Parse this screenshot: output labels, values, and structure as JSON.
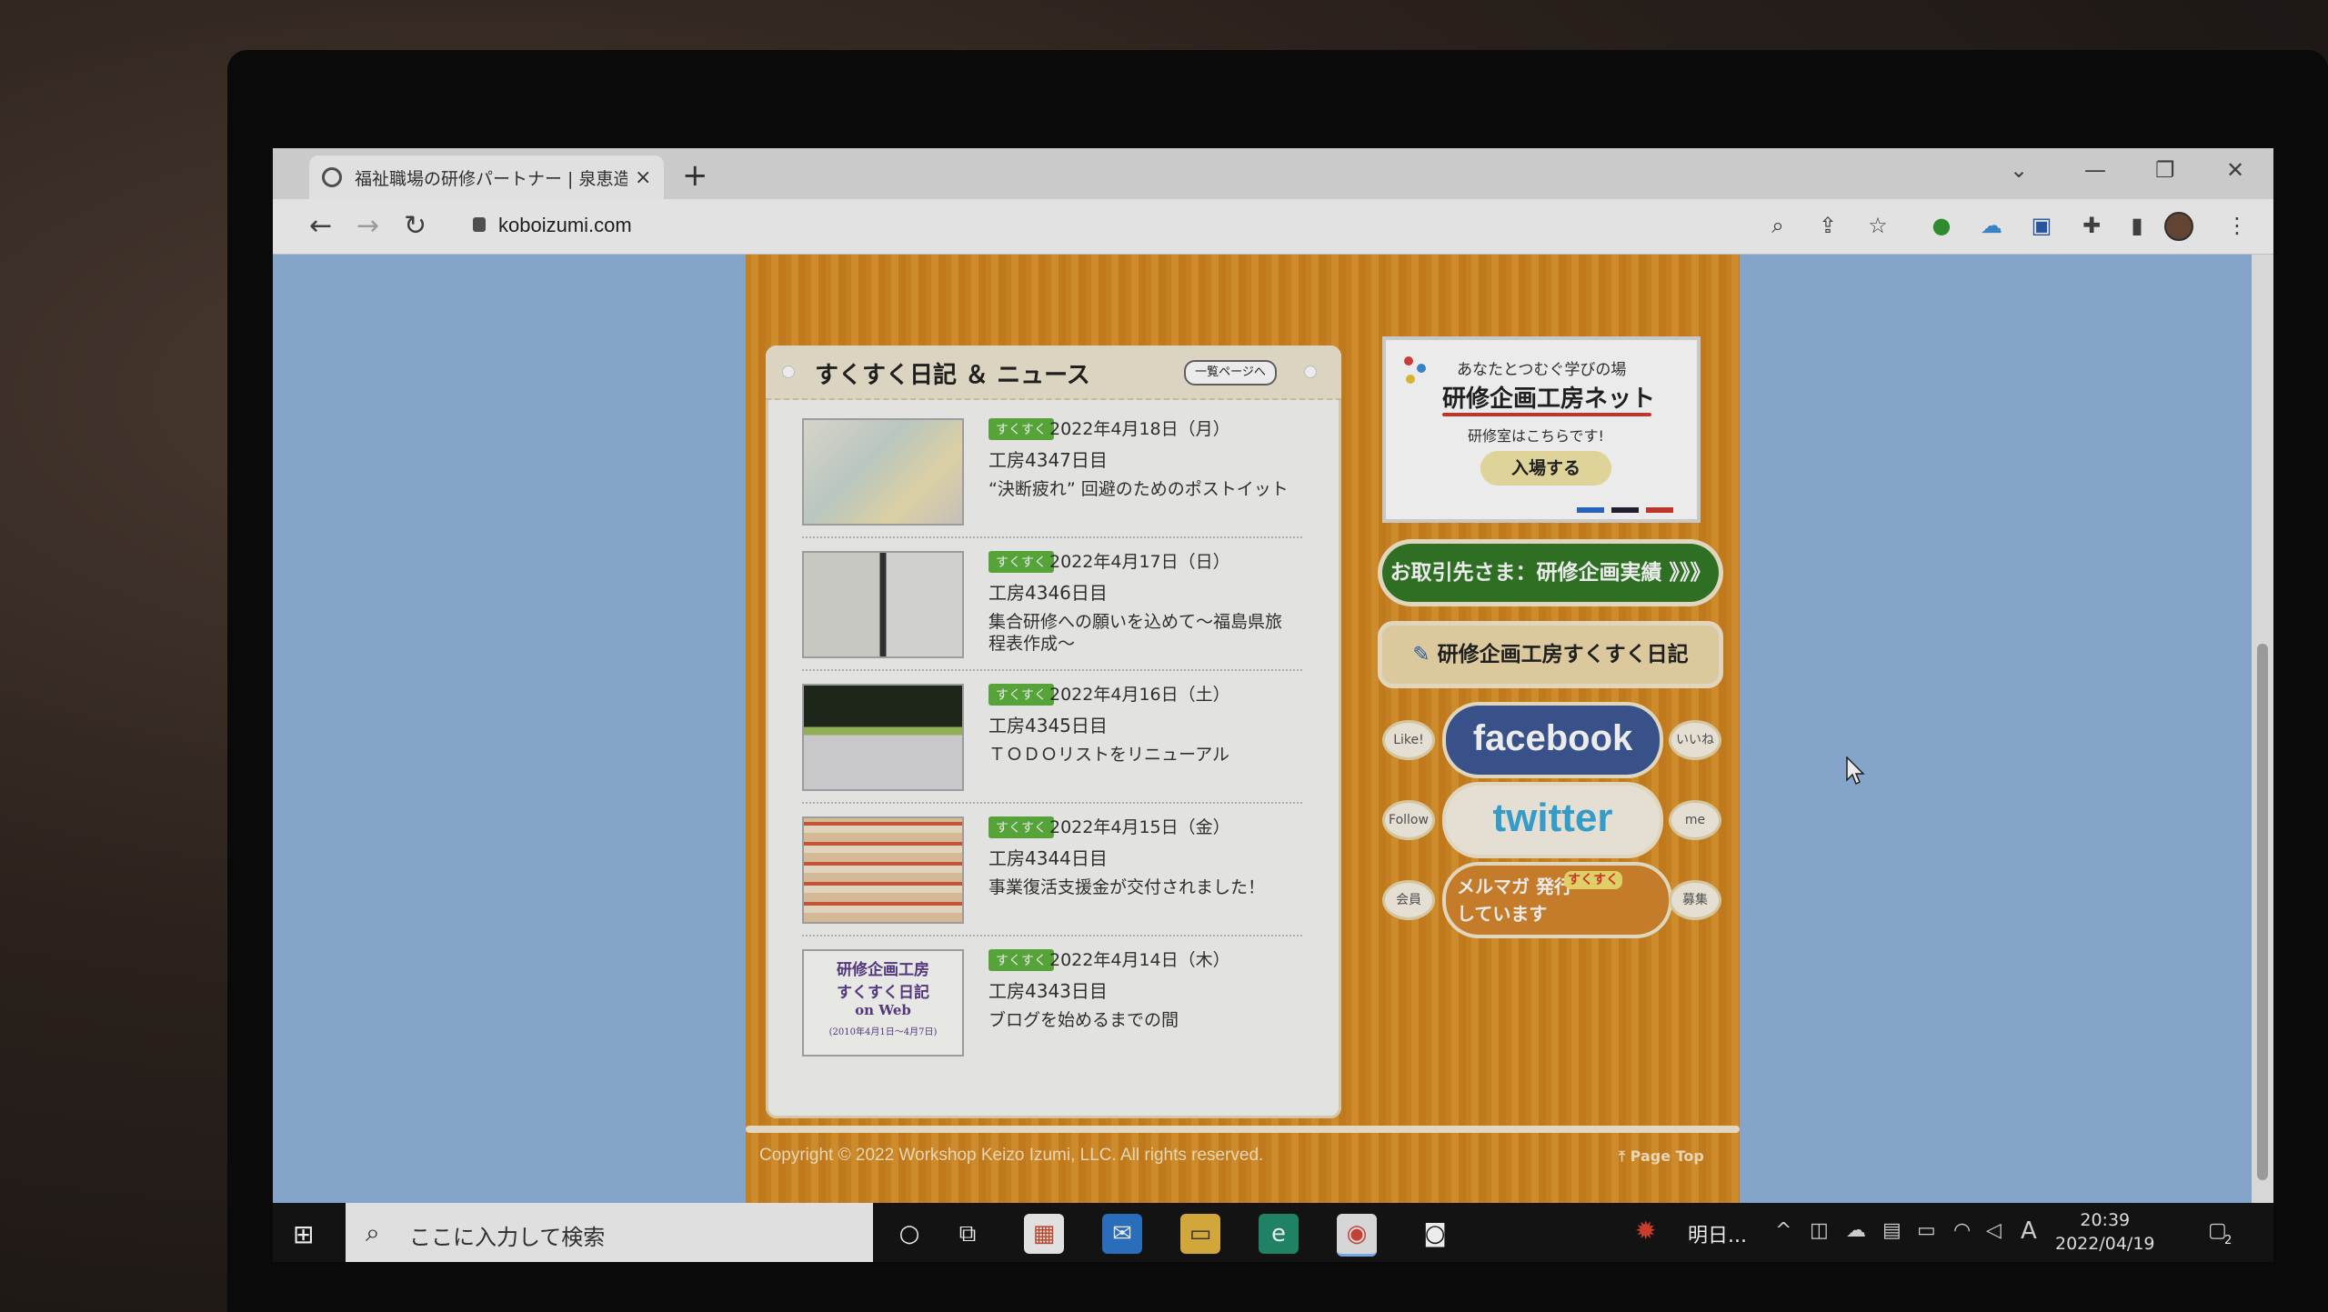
{
  "browser": {
    "tab_title": "福祉職場の研修パートナー | 泉恵造",
    "tab_close": "×",
    "new_tab": "+",
    "url": "koboizumi.com",
    "back": "←",
    "forward": "→",
    "reload": "↻"
  },
  "news": {
    "title": "すくすく日記 ＆ ニュース",
    "more_label": "一覧ページへ",
    "items": [
      {
        "badge": "すくすく",
        "date": "2022年4月18日（月）",
        "day": "工房4347日目",
        "post": "“決断疲れ” 回避のためのポストイット"
      },
      {
        "badge": "すくすく",
        "date": "2022年4月17日（日）",
        "day": "工房4346日目",
        "post": "集合研修への願いを込めて～福島県旅程表作成～"
      },
      {
        "badge": "すくすく",
        "date": "2022年4月16日（土）",
        "day": "工房4345日目",
        "post": "ＴＯＤＯリストをリニューアル"
      },
      {
        "badge": "すくすく",
        "date": "2022年4月15日（金）",
        "day": "工房4344日目",
        "post": "事業復活支援金が交付されました！"
      },
      {
        "badge": "すくすく",
        "date": "2022年4月14日（木）",
        "day": "工房4343日目",
        "post": "ブログを始めるまでの間"
      }
    ],
    "book_thumb": {
      "line1": "研修企画工房",
      "line2": "すくすく日記",
      "line3": "on Web",
      "line4": "(2010年4月1日～4月7日)"
    }
  },
  "sidebar": {
    "promo_line1": "あなたとつむぐ学びの場",
    "promo_line2": "研修企画工房ネット",
    "promo_line3": "研修室はこちらです!",
    "promo_enter": "入場する",
    "results_label": "お取引先さま：研修企画実績 》》》",
    "diary_label": "研修企画工房すくすく日記",
    "facebook": {
      "left": "Like!",
      "main": "facebook",
      "right": "いいね"
    },
    "twitter": {
      "left": "Follow",
      "main": "twitter",
      "right": "me"
    },
    "mailmag": {
      "left": "会員",
      "main": "メルマガ 発行しています",
      "right": "募集",
      "sticker": "すくすく"
    }
  },
  "footer": {
    "copyright": "Copyright © 2022 Workshop Keizo Izumi, LLC. All rights reserved.",
    "page_top": "Page Top"
  },
  "taskbar": {
    "search_placeholder": "ここに入力して検索",
    "weather_text": "明日...",
    "time": "20:39",
    "date": "2022/04/19",
    "ime": "A",
    "notification_count": "2"
  },
  "colors": {
    "page_bg": "#8fb3dd",
    "main_orange": "#e0921f",
    "badge_green": "#5ab33a",
    "results_green": "#2f7a23",
    "facebook_blue": "#3b5998",
    "twitter_blue": "#35a9dd"
  }
}
